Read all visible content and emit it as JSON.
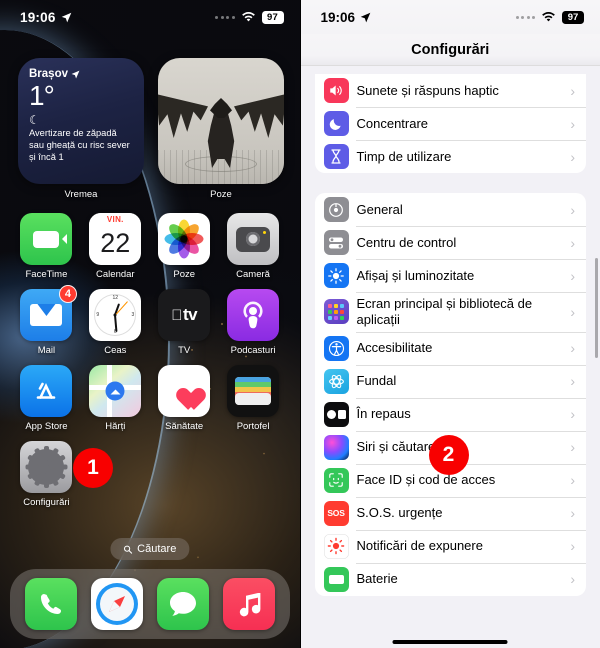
{
  "status_bar": {
    "time": "19:06",
    "location_icon": "location-arrow-icon",
    "signal_icon": "cellular-dots-icon",
    "wifi_icon": "wifi-icon",
    "battery_level": "97"
  },
  "home_screen": {
    "widgets": [
      {
        "name": "weather-widget",
        "label": "Vremea",
        "city": "Brașov",
        "temperature": "1°",
        "condition_icon": "moon-icon",
        "alert": "Avertizare de zăpadă sau gheață cu risc sever și încă 1"
      },
      {
        "name": "photos-widget",
        "label": "Poze"
      }
    ],
    "apps": [
      {
        "label": "FaceTime",
        "icon": "facetime-icon",
        "badge": null
      },
      {
        "label": "Calendar",
        "icon": "calendar-icon",
        "badge": null,
        "day_name": "VIN.",
        "day_number": "22"
      },
      {
        "label": "Poze",
        "icon": "photos-icon",
        "badge": null
      },
      {
        "label": "Cameră",
        "icon": "camera-icon",
        "badge": null
      },
      {
        "label": "Mail",
        "icon": "mail-icon",
        "badge": "4"
      },
      {
        "label": "Ceas",
        "icon": "clock-icon",
        "badge": null
      },
      {
        "label": "TV",
        "icon": "appletv-icon",
        "badge": null,
        "wordmark": "tv"
      },
      {
        "label": "Podcasturi",
        "icon": "podcasts-icon",
        "badge": null
      },
      {
        "label": "App Store",
        "icon": "appstore-icon",
        "badge": null
      },
      {
        "label": "Hărți",
        "icon": "maps-icon",
        "badge": null
      },
      {
        "label": "Sănătate",
        "icon": "health-icon",
        "badge": null
      },
      {
        "label": "Portofel",
        "icon": "wallet-icon",
        "badge": null
      },
      {
        "label": "Configurări",
        "icon": "settings-icon",
        "badge": null
      }
    ],
    "search": {
      "label": "Căutare",
      "icon": "search-icon"
    },
    "dock": [
      {
        "name": "phone",
        "icon": "phone-icon"
      },
      {
        "name": "safari",
        "icon": "safari-icon"
      },
      {
        "name": "messages",
        "icon": "messages-icon"
      },
      {
        "name": "music",
        "icon": "music-icon"
      }
    ]
  },
  "settings_screen": {
    "title": "Configurări",
    "chevron": "›",
    "groups": [
      {
        "name": "group-1",
        "rows": [
          {
            "label": "Sunete și răspuns haptic",
            "icon": "speaker-icon",
            "icon_color": "#f8375a"
          },
          {
            "label": "Concentrare",
            "icon": "moon-icon",
            "icon_color": "#5e5ce6"
          },
          {
            "label": "Timp de utilizare",
            "icon": "hourglass-icon",
            "icon_color": "#5e5ce6"
          }
        ]
      },
      {
        "name": "group-2",
        "rows": [
          {
            "label": "General",
            "icon": "gear-icon",
            "icon_color": "#8e8e93"
          },
          {
            "label": "Centru de control",
            "icon": "sliders-icon",
            "icon_color": "#8e8e93"
          },
          {
            "label": "Afișaj și luminozitate",
            "icon": "brightness-icon",
            "icon_color": "#1575f3"
          },
          {
            "label": "Ecran principal și bibliotecă de aplicații",
            "icon": "app-grid-icon",
            "icon_color": "#6f4fd0"
          },
          {
            "label": "Accesibilitate",
            "icon": "accessibility-icon",
            "icon_color": "#1575f3"
          },
          {
            "label": "Fundal",
            "icon": "wallpaper-icon",
            "icon_color": "#2fb5e8"
          },
          {
            "label": "În repaus",
            "icon": "standby-icon",
            "icon_color": "#0c0c0e"
          },
          {
            "label": "Siri și căutarea",
            "icon": "siri-icon",
            "icon_color": "#8a4bff"
          },
          {
            "label": "Face ID și cod de acces",
            "icon": "faceid-icon",
            "icon_color": "#34c759"
          },
          {
            "label": "S.O.S. urgențe",
            "icon": "sos-icon",
            "icon_color": "#ff3b30",
            "icon_text": "SOS"
          },
          {
            "label": "Notificări de expunere",
            "icon": "exposure-icon",
            "icon_color": "#ffffff"
          },
          {
            "label": "Baterie",
            "icon": "battery-icon",
            "icon_color": "#34c759"
          }
        ]
      }
    ]
  },
  "callouts": [
    {
      "number": "1",
      "target": "settings-app-icon",
      "color": "#f80000"
    },
    {
      "number": "2",
      "target": "standby-settings-row",
      "color": "#f80000"
    }
  ]
}
